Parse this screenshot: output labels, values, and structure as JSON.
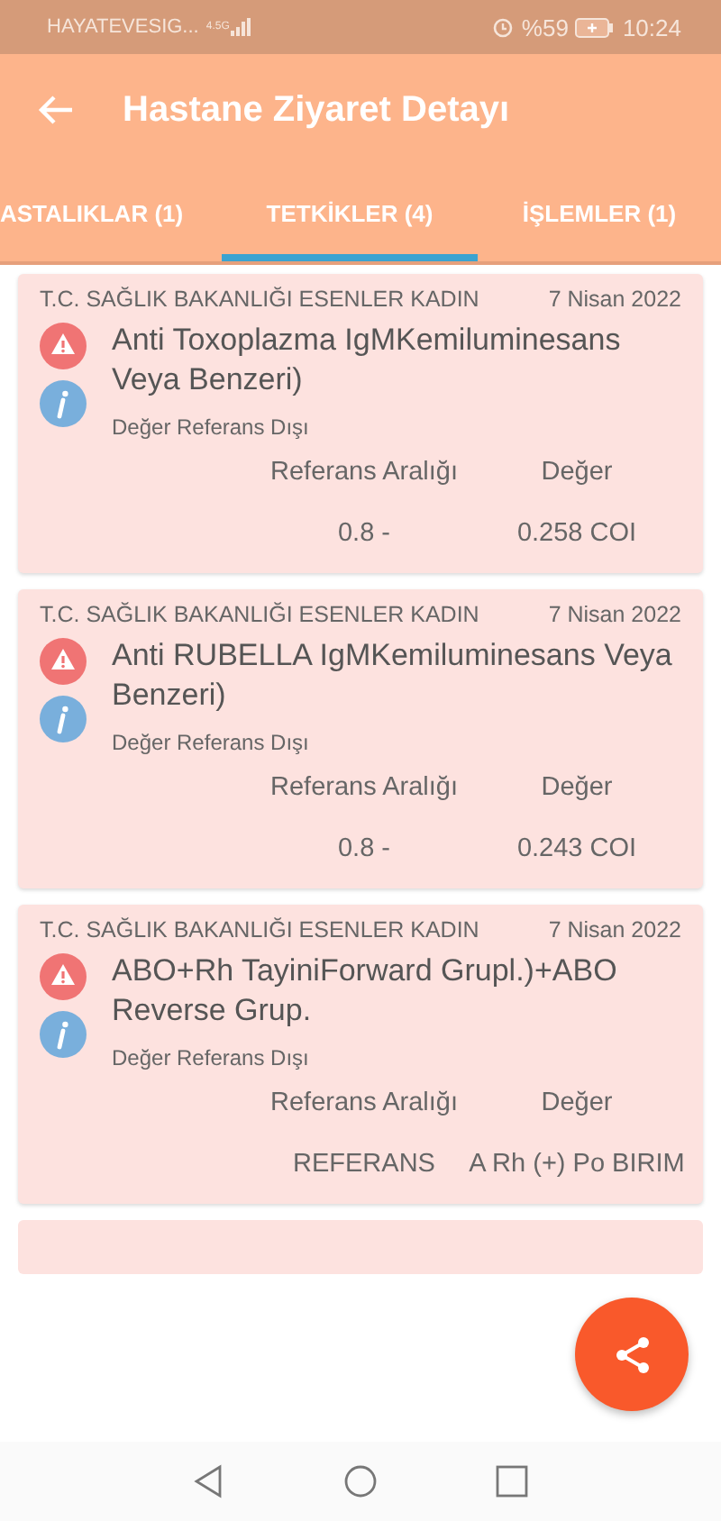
{
  "status_bar": {
    "carrier": "HAYATEVESIG...",
    "network": "4.5G",
    "battery": "%59",
    "time": "10:24"
  },
  "app_bar": {
    "title": "Hastane Ziyaret Detayı"
  },
  "tabs": [
    {
      "label": "ASTALIKLAR (1)",
      "selected": false
    },
    {
      "label": "TETKİKLER (4)",
      "selected": true
    },
    {
      "label": "İŞLEMLER (1)",
      "selected": false
    }
  ],
  "results": [
    {
      "hospital": "T.C. SAĞLIK BAKANLIĞI ESENLER KADIN",
      "date": "7 Nisan 2022",
      "test": "Anti Toxoplazma IgMKemiluminesans Veya Benzeri)",
      "status": "Değer Referans Dışı",
      "reference_label": "Referans Aralığı",
      "value_label": "Değer",
      "reference": "0.8 -",
      "value": "0.258 COI"
    },
    {
      "hospital": "T.C. SAĞLIK BAKANLIĞI ESENLER KADIN",
      "date": "7 Nisan 2022",
      "test": "Anti RUBELLA IgMKemiluminesans Veya Benzeri)",
      "status": "Değer Referans Dışı",
      "reference_label": "Referans Aralığı",
      "value_label": "Değer",
      "reference": "0.8 -",
      "value": "0.243 COI"
    },
    {
      "hospital": "T.C. SAĞLIK BAKANLIĞI ESENLER KADIN",
      "date": "7 Nisan 2022",
      "test": "ABO+Rh TayiniForward Grupl.)+ABO Reverse Grup.",
      "status": "Değer Referans Dışı",
      "reference_label": "Referans Aralığı",
      "value_label": "Değer",
      "reference": "REFERANS",
      "value": "A Rh (+) Po BIRIM"
    }
  ]
}
